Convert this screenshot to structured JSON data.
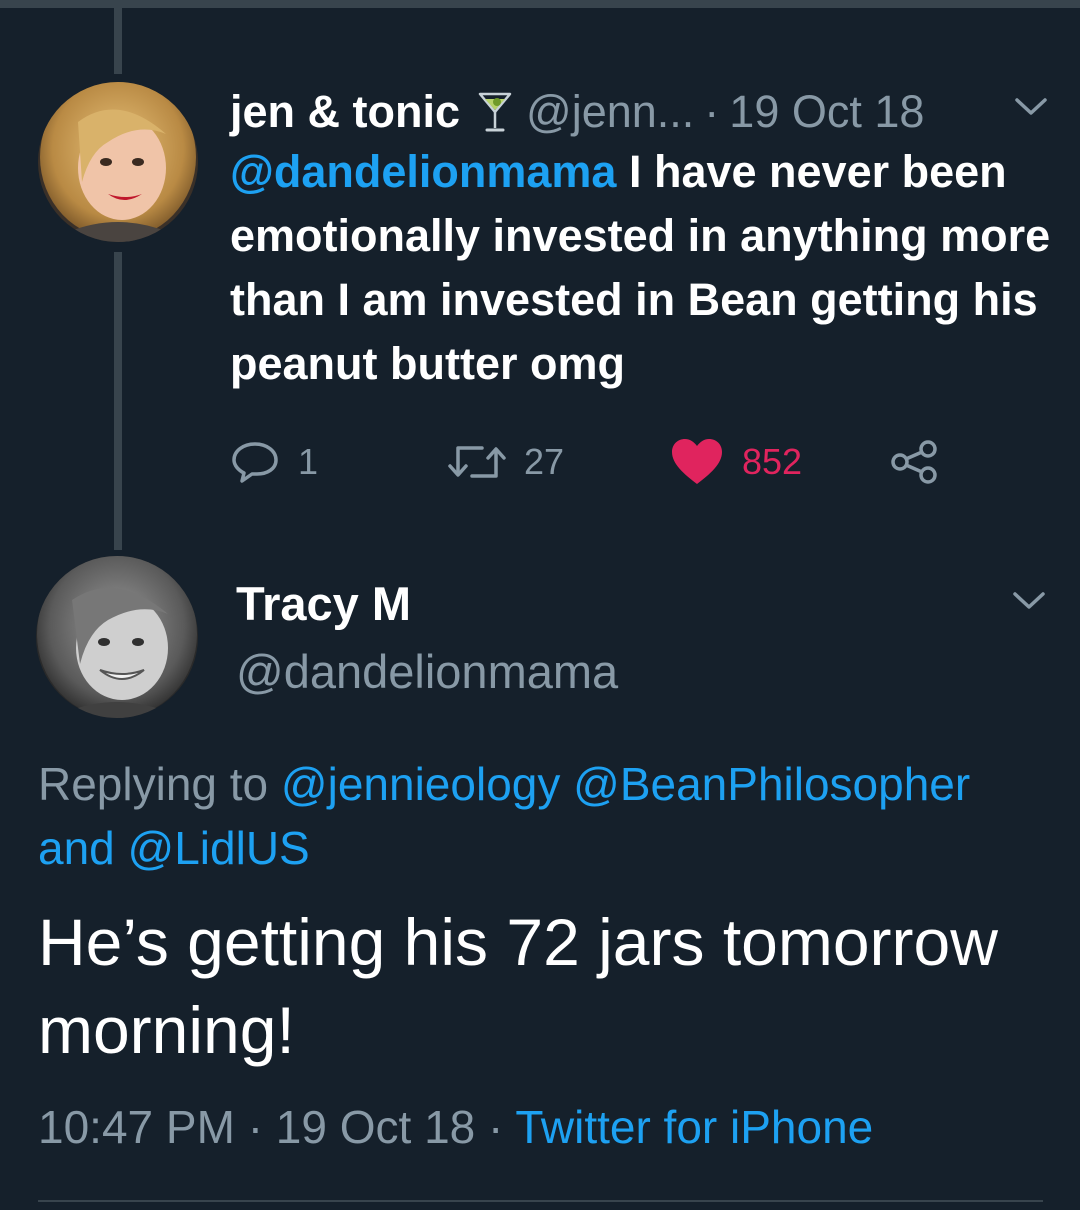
{
  "parent_tweet": {
    "display_name": "jen & tonic",
    "handle": "@jenn...",
    "separator": "·",
    "date": "19 Oct 18",
    "mention": "@dandelionmama",
    "text": " I have never been emotionally invested in anything more than I am invested in Bean getting his peanut butter omg",
    "reply_count": "1",
    "retweet_count": "27",
    "like_count": "852",
    "emoji_icon": "cocktail-glass-icon"
  },
  "main_tweet": {
    "display_name": "Tracy M",
    "handle": "@dandelionmama",
    "replying_prefix": "Replying to",
    "replying_mention_1": "@jennieology",
    "replying_mention_2": "@BeanPhilosopher",
    "replying_and": "and",
    "replying_mention_3": "@LidlUS",
    "text": "He’s getting his 72 jars tomorrow morning!",
    "time": "10:47 PM",
    "sep1": "·",
    "date": "19 Oct 18",
    "sep2": "·",
    "source": "Twitter for iPhone"
  },
  "colors": {
    "background": "#15202b",
    "accent": "#1da1f2",
    "muted": "#8899a6",
    "like": "#e0245e",
    "divider": "#38444d"
  }
}
